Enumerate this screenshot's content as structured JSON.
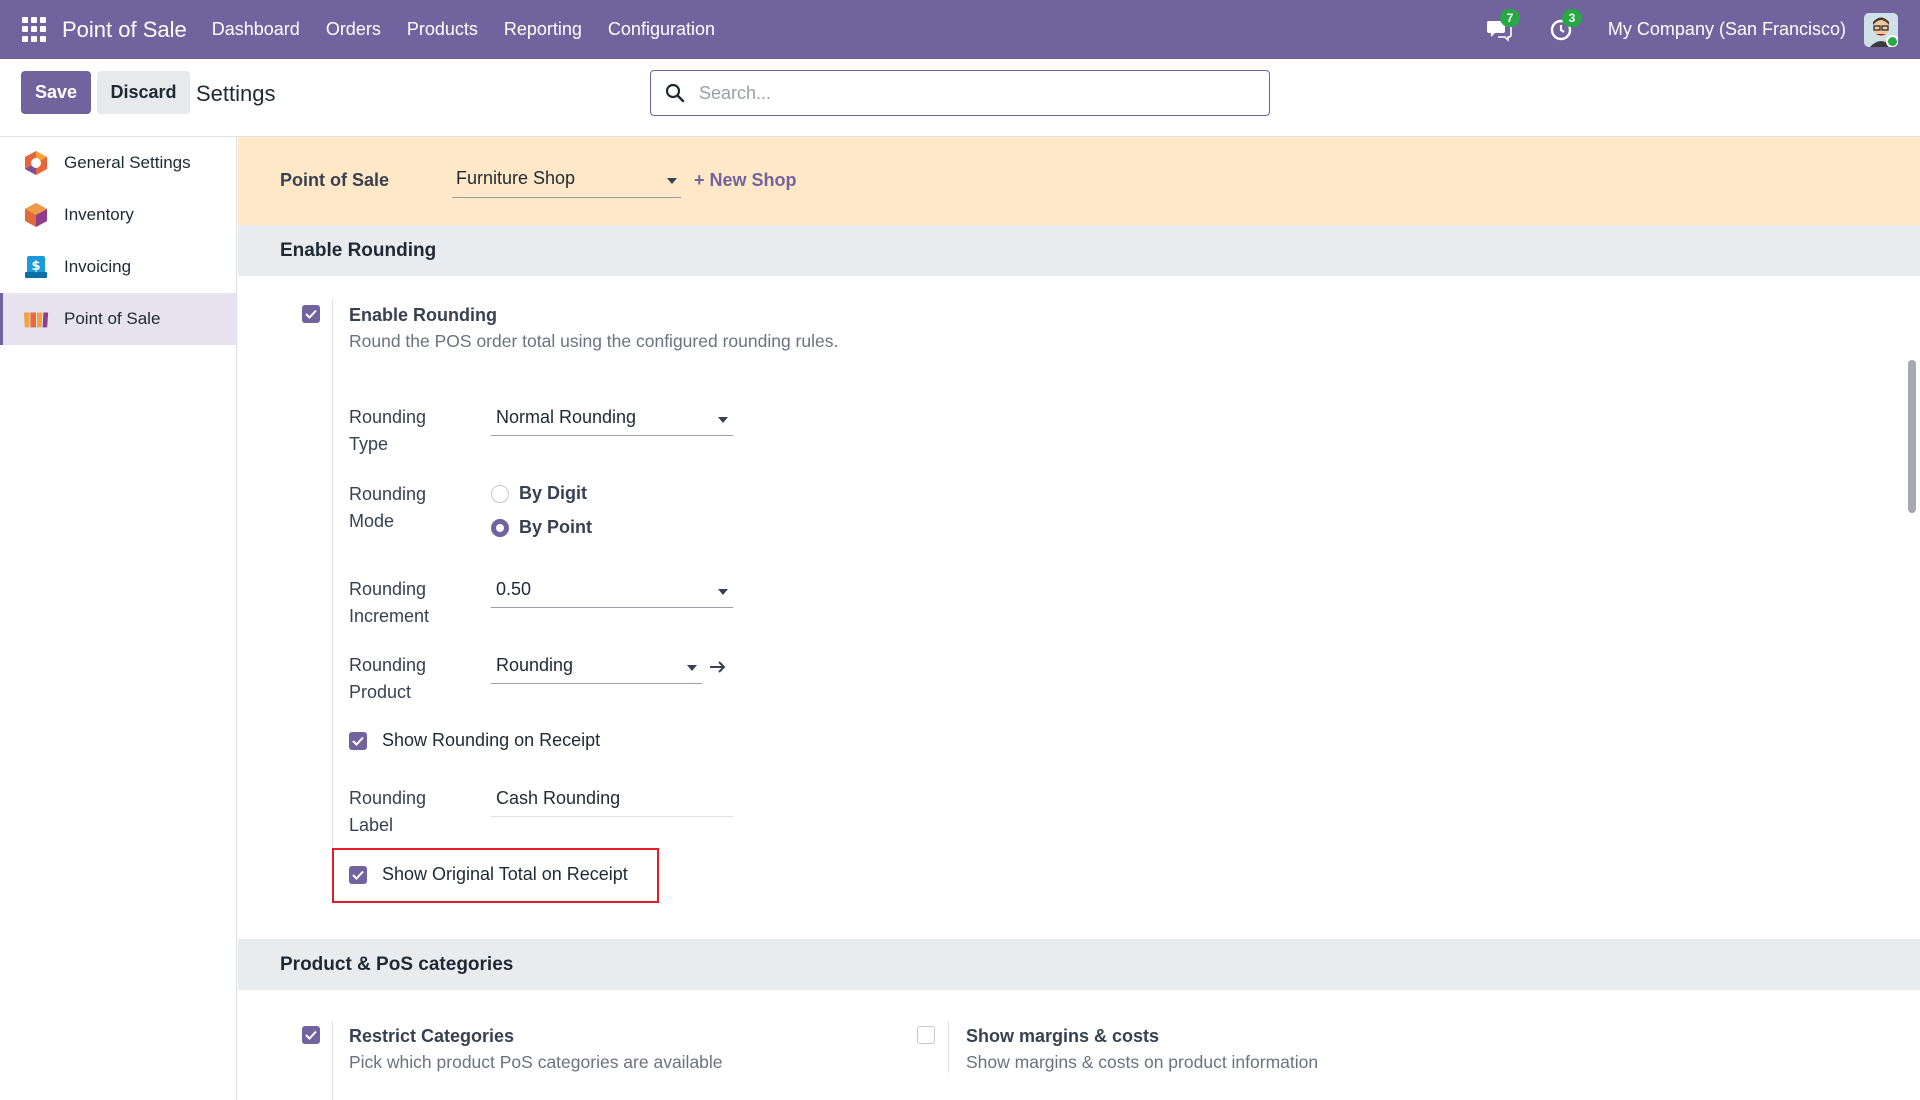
{
  "navbar": {
    "app_title": "Point of Sale",
    "menu": [
      "Dashboard",
      "Orders",
      "Products",
      "Reporting",
      "Configuration"
    ],
    "messages_count": "7",
    "activities_count": "3",
    "company": "My Company (San Francisco)",
    "accent_color": "#71639e"
  },
  "control": {
    "save_label": "Save",
    "discard_label": "Discard",
    "title": "Settings",
    "search_placeholder": "Search..."
  },
  "sidebar": {
    "items": [
      {
        "label": "General Settings",
        "icon": "general-settings-icon"
      },
      {
        "label": "Inventory",
        "icon": "inventory-icon"
      },
      {
        "label": "Invoicing",
        "icon": "invoicing-icon"
      },
      {
        "label": "Point of Sale",
        "icon": "point-of-sale-icon",
        "active": true
      }
    ]
  },
  "shop": {
    "label": "Point of Sale",
    "selected": "Furniture Shop",
    "new_shop": "+ New Shop"
  },
  "rounding_section": {
    "header": "Enable Rounding",
    "enable": {
      "title": "Enable Rounding",
      "description": "Round the POS order total using the configured rounding rules.",
      "checked": true
    },
    "type": {
      "label": "Rounding Type",
      "value": "Normal Rounding"
    },
    "mode": {
      "label": "Rounding Mode",
      "options": [
        {
          "label": "By Digit",
          "selected": false
        },
        {
          "label": "By Point",
          "selected": true
        }
      ]
    },
    "increment": {
      "label": "Rounding Increment",
      "value": "0.50"
    },
    "product": {
      "label": "Rounding Product",
      "value": "Rounding"
    },
    "show_on_receipt": {
      "label": "Show Rounding on Receipt",
      "checked": true
    },
    "rounding_label": {
      "label": "Rounding Label",
      "value": "Cash Rounding"
    },
    "show_original_total": {
      "label": "Show Original Total on Receipt",
      "checked": true
    }
  },
  "categories_section": {
    "header": "Product & PoS categories",
    "restrict": {
      "title": "Restrict Categories",
      "description": "Pick which product PoS categories are available",
      "checked": true
    },
    "margins": {
      "title": "Show margins & costs",
      "description": "Show margins & costs on product information",
      "checked": false
    }
  }
}
